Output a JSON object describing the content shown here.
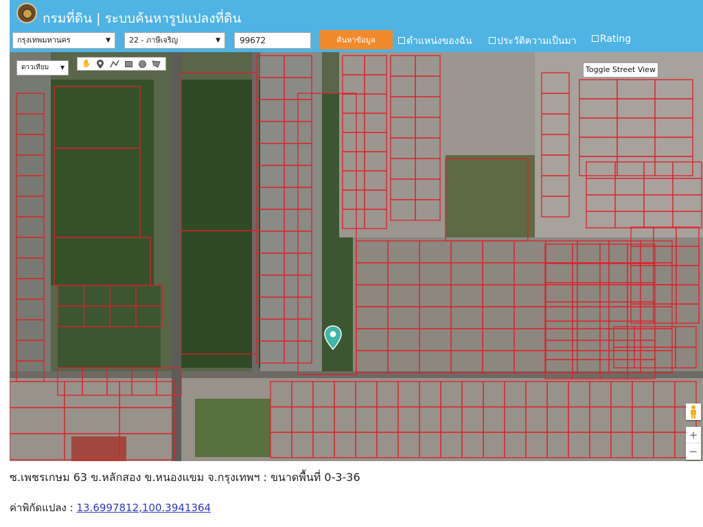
{
  "header": {
    "title": "กรมที่ดิน | ระบบค้นหารูปแปลงที่ดิน",
    "province_select": "กรุงเทพมหานคร",
    "district_select": "22 - ภาษีเจริญ",
    "parcel_number": "99672",
    "search_button": "ค้นหาข้อมูล",
    "options": [
      {
        "label": "ตำแหน่งของฉัน"
      },
      {
        "label": "ประวัติความเป็นมา"
      },
      {
        "label": "Rating"
      }
    ]
  },
  "map": {
    "map_type": "ดาวเทียม",
    "street_view_button": "Toggle Street View",
    "tools": [
      "hand-icon",
      "marker-icon",
      "polyline-icon",
      "rectangle-icon",
      "circle-icon",
      "polygon-icon"
    ],
    "zoom_in": "+",
    "zoom_out": "−",
    "parcel_line_color": "#e0202a"
  },
  "result": {
    "address": "ซ.เพชรเกษม 63 ข.หลักสอง ข.หนองแขม จ.กรุงเทพฯ :",
    "area": "ขนาดพื้นที่ 0-3-36",
    "coord_label": "ค่าพิกัดแปลง :",
    "coord_value": "13.6997812,100.3941364"
  }
}
